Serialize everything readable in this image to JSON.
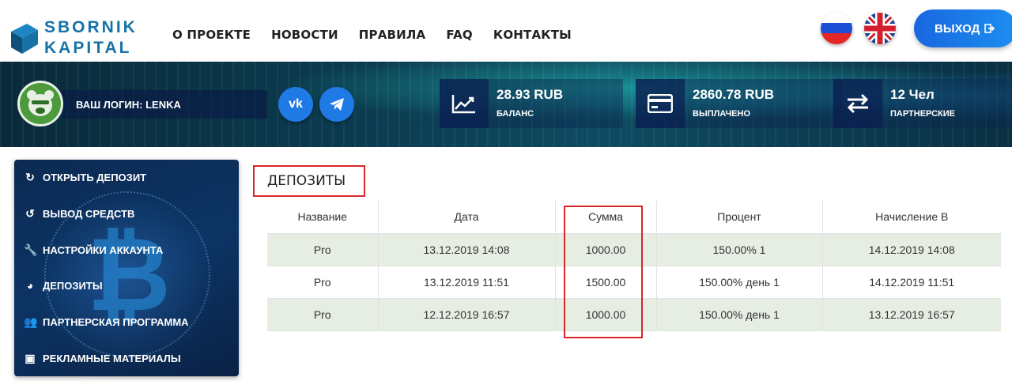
{
  "brand": {
    "line1": "SBORNIK",
    "line2": "KAPITAL",
    "color": "#1773a6"
  },
  "nav": [
    {
      "label": "О ПРОЕКТЕ"
    },
    {
      "label": "НОВОСТИ"
    },
    {
      "label": "ПРАВИЛА"
    },
    {
      "label": "FAQ"
    },
    {
      "label": "КОНТАКТЫ"
    }
  ],
  "languages": [
    {
      "icon": "russia-flag-icon"
    },
    {
      "icon": "uk-flag-icon"
    }
  ],
  "logout": {
    "label": "ВЫХОД",
    "icon": "sign-out-icon"
  },
  "user": {
    "login_text": "ВАШ ЛОГИН: LENKA",
    "avatar_icon": "bear-avatar-icon"
  },
  "social": {
    "vk_label": "vk",
    "telegram_icon": "telegram-icon"
  },
  "stats": [
    {
      "value": "28.93 RUB",
      "label": "БАЛАНС",
      "icon": "chart-line-icon"
    },
    {
      "value": "2860.78 RUB",
      "label": "ВЫПЛАЧЕНО",
      "icon": "credit-card-icon"
    },
    {
      "value": "12 Чел",
      "label": "ПАРТНЕРСКИЕ",
      "icon": "exchange-icon"
    }
  ],
  "sidebar": {
    "items": [
      {
        "label": "ОТКРЫТЬ ДЕПОЗИТ",
        "icon": "refresh-icon"
      },
      {
        "label": "ВЫВОД СРЕДСТВ",
        "icon": "undo-icon"
      },
      {
        "label": "НАСТРОЙКИ АККАУНТА",
        "icon": "wrench-icon"
      },
      {
        "label": "ДЕПОЗИТЫ",
        "icon": "pie-chart-icon"
      },
      {
        "label": "ПАРТНЕРСКАЯ ПРОГРАММА",
        "icon": "users-icon"
      },
      {
        "label": "РЕКЛАМНЫЕ МАТЕРИАЛЫ",
        "icon": "image-icon"
      }
    ]
  },
  "deposits": {
    "title": "ДЕПОЗИТЫ",
    "columns": [
      "Название",
      "Дата",
      "Сумма",
      "Процент",
      "Начисление В"
    ],
    "rows": [
      [
        "Pro",
        "13.12.2019 14:08",
        "1000.00",
        "150.00% 1",
        "14.12.2019 14:08"
      ],
      [
        "Pro",
        "13.12.2019 11:51",
        "1500.00",
        "150.00% день 1",
        "14.12.2019 11:51"
      ],
      [
        "Pro",
        "12.12.2019 16:57",
        "1000.00",
        "150.00% день 1",
        "13.12.2019 16:57"
      ]
    ],
    "highlight_color": "#d8262a"
  }
}
